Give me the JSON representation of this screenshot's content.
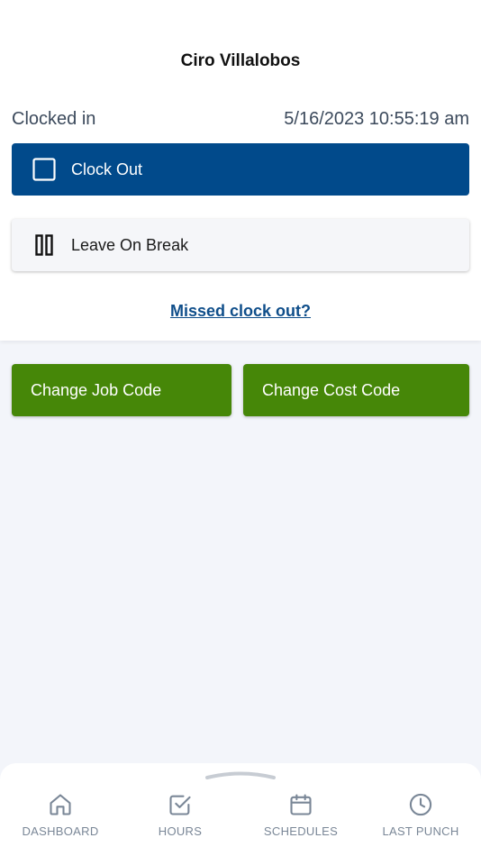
{
  "user": {
    "name": "Ciro Villalobos"
  },
  "status": {
    "label": "Clocked in",
    "timestamp": "5/16/2023 10:55:19 am"
  },
  "actions": {
    "clock_out_label": "Clock Out",
    "break_label": "Leave On Break",
    "missed_link": "Missed clock out?",
    "job_code_label": "Change Job Code",
    "cost_code_label": "Change Cost Code"
  },
  "nav": {
    "items": [
      {
        "label": "DASHBOARD",
        "icon": "home-icon"
      },
      {
        "label": "HOURS",
        "icon": "checkbox-icon"
      },
      {
        "label": "SCHEDULES",
        "icon": "calendar-icon"
      },
      {
        "label": "LAST PUNCH",
        "icon": "clock-icon"
      }
    ]
  },
  "colors": {
    "primary_blue": "#014a8b",
    "green": "#468708",
    "link_blue": "#0f4e8a",
    "background": "#f3f5fa"
  }
}
